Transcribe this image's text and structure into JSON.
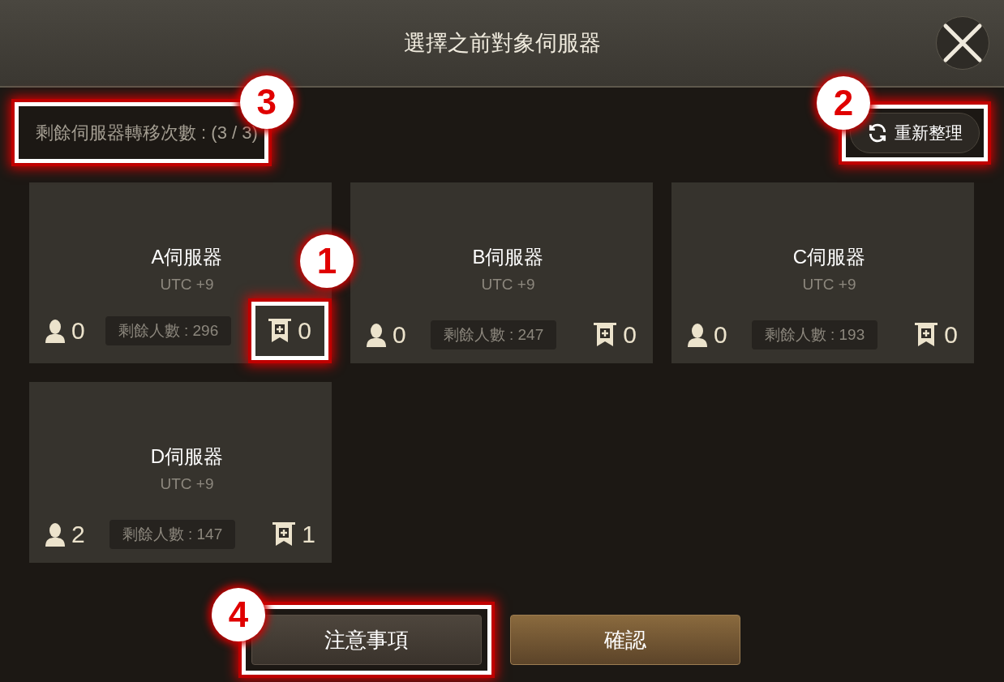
{
  "dialog": {
    "title": "選擇之前對象伺服器",
    "remaining_transfers": {
      "text": "剩餘伺服器轉移次數 : (3 / 3)",
      "callout": "3"
    },
    "refresh_button": {
      "label": "重新整理",
      "callout": "2"
    },
    "servers": [
      {
        "name": "A伺服器",
        "timezone": "UTC +9",
        "players": "0",
        "remaining": "剩餘人數 : 296",
        "guilds": "0",
        "guilds_callout": "1"
      },
      {
        "name": "B伺服器",
        "timezone": "UTC +9",
        "players": "0",
        "remaining": "剩餘人數 : 247",
        "guilds": "0"
      },
      {
        "name": "C伺服器",
        "timezone": "UTC +9",
        "players": "0",
        "remaining": "剩餘人數 : 193",
        "guilds": "0"
      },
      {
        "name": "D伺服器",
        "timezone": "UTC +9",
        "players": "2",
        "remaining": "剩餘人數 : 147",
        "guilds": "1"
      }
    ],
    "buttons": [
      {
        "label": "注意事項",
        "kind": "secondary",
        "callout": "4"
      },
      {
        "label": "確認",
        "kind": "primary"
      }
    ]
  }
}
